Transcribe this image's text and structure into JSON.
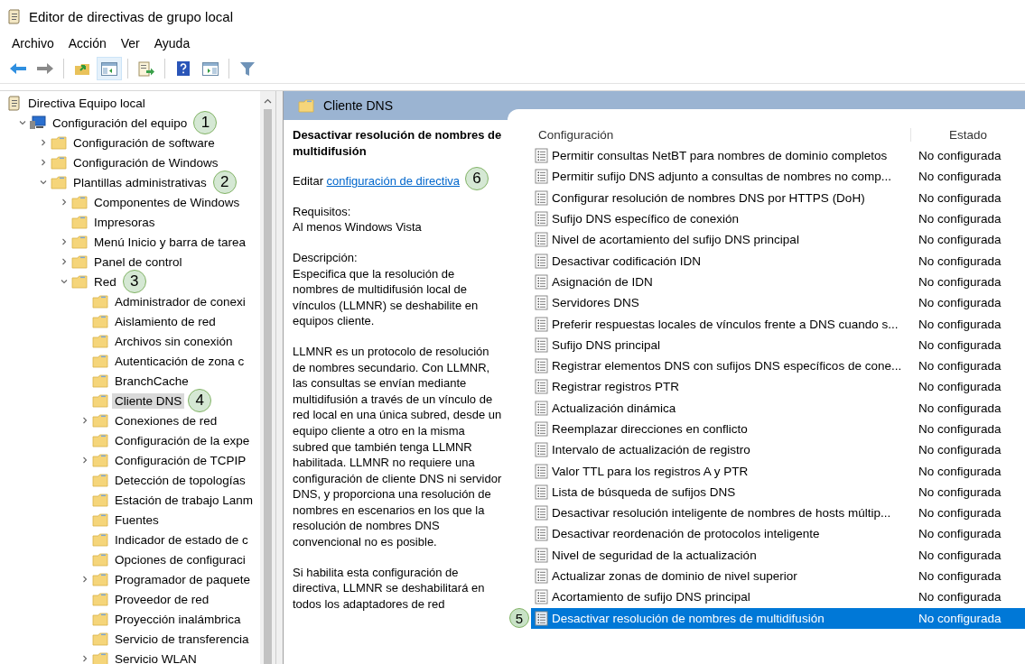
{
  "window": {
    "title": "Editor de directivas de grupo local"
  },
  "menu": [
    {
      "label": "Archivo"
    },
    {
      "label": "Acción"
    },
    {
      "label": "Ver"
    },
    {
      "label": "Ayuda"
    }
  ],
  "toolbar": [
    {
      "kind": "back",
      "pressed": false
    },
    {
      "kind": "forward",
      "pressed": false
    },
    {
      "kind": "separator"
    },
    {
      "kind": "up",
      "pressed": false
    },
    {
      "kind": "tree",
      "pressed": true
    },
    {
      "kind": "separator"
    },
    {
      "kind": "export",
      "pressed": false
    },
    {
      "kind": "separator"
    },
    {
      "kind": "help",
      "pressed": false
    },
    {
      "kind": "pane",
      "pressed": false
    },
    {
      "kind": "separator"
    },
    {
      "kind": "filter",
      "pressed": false
    }
  ],
  "tree": {
    "label": "Directiva Equipo local",
    "selected": false,
    "children": [
      {
        "label": "Configuración del equipo",
        "expanded": true,
        "selected": false,
        "badge": "1",
        "children": [
          {
            "label": "Configuración de software",
            "expanded": false,
            "selected": false
          },
          {
            "label": "Configuración de Windows",
            "expanded": false,
            "selected": false
          },
          {
            "label": "Plantillas administrativas",
            "expanded": true,
            "selected": false,
            "badge": "2",
            "children": [
              {
                "label": "Componentes de Windows",
                "expanded": false,
                "selected": false
              },
              {
                "label": "Impresoras",
                "selected": false
              },
              {
                "label": "Menú Inicio y barra de tarea",
                "expanded": false,
                "selected": false
              },
              {
                "label": "Panel de control",
                "expanded": false,
                "selected": false
              },
              {
                "label": "Red",
                "expanded": true,
                "selected": false,
                "badge": "3",
                "children": [
                  {
                    "label": "Administrador de conexi",
                    "selected": false
                  },
                  {
                    "label": "Aislamiento de red",
                    "selected": false
                  },
                  {
                    "label": "Archivos sin conexión",
                    "selected": false
                  },
                  {
                    "label": "Autenticación de zona c",
                    "selected": false
                  },
                  {
                    "label": "BranchCache",
                    "selected": false
                  },
                  {
                    "label": "Cliente DNS",
                    "selected": true,
                    "badge": "4"
                  },
                  {
                    "label": "Conexiones de red",
                    "expanded": false,
                    "selected": false
                  },
                  {
                    "label": "Configuración de la expe",
                    "selected": false
                  },
                  {
                    "label": "Configuración de TCPIP",
                    "expanded": false,
                    "selected": false
                  },
                  {
                    "label": "Detección de topologías",
                    "selected": false
                  },
                  {
                    "label": "Estación de trabajo Lanm",
                    "selected": false
                  },
                  {
                    "label": "Fuentes",
                    "selected": false
                  },
                  {
                    "label": "Indicador de estado de c",
                    "selected": false
                  },
                  {
                    "label": "Opciones de configuraci",
                    "selected": false
                  },
                  {
                    "label": "Programador de paquete",
                    "expanded": false,
                    "selected": false
                  },
                  {
                    "label": "Proveedor de red",
                    "selected": false
                  },
                  {
                    "label": "Proyección inalámbrica",
                    "selected": false
                  },
                  {
                    "label": "Servicio de transferencia",
                    "selected": false
                  },
                  {
                    "label": "Servicio WLAN",
                    "expanded": false,
                    "selected": false
                  }
                ]
              }
            ]
          }
        ]
      }
    ]
  },
  "content_header": {
    "title": "Cliente DNS"
  },
  "description": {
    "title": "Desactivar resolución de nombres de multidifusión",
    "badge": "6",
    "edit_prefix": "Editar",
    "edit_link": "configuración de directiva",
    "requirements_label": "Requisitos:",
    "requirements": "Al menos Windows Vista",
    "description_label": "Descripción:",
    "paragraphs": [
      "Especifica que la resolución de nombres de multidifusión local de vínculos (LLMNR) se deshabilite en equipos cliente.",
      "LLMNR es un protocolo de resolución de nombres secundario. Con LLMNR, las consultas se envían mediante multidifusión a través de un vínculo de red local en una única subred, desde un equipo cliente a otro en la misma subred que también tenga LLMNR habilitada. LLMNR no requiere una configuración de cliente DNS ni servidor DNS, y proporciona una resolución de nombres en escenarios en los que la resolución de nombres DNS convencional no es posible.",
      "Si habilita esta configuración de directiva, LLMNR se deshabilitará en todos los adaptadores de red"
    ]
  },
  "settings": {
    "columns": [
      "Configuración",
      "Estado"
    ],
    "rows": [
      {
        "name": "Permitir consultas NetBT para nombres de dominio completos",
        "state": "No configurada",
        "selected": false
      },
      {
        "name": "Permitir sufijo DNS adjunto a consultas de nombres no comp...",
        "state": "No configurada",
        "selected": false
      },
      {
        "name": "Configurar resolución de nombres DNS por HTTPS (DoH)",
        "state": "No configurada",
        "selected": false
      },
      {
        "name": "Sufijo DNS específico de conexión",
        "state": "No configurada",
        "selected": false
      },
      {
        "name": "Nivel de acortamiento del sufijo DNS principal",
        "state": "No configurada",
        "selected": false
      },
      {
        "name": "Desactivar codificación IDN",
        "state": "No configurada",
        "selected": false
      },
      {
        "name": "Asignación de IDN",
        "state": "No configurada",
        "selected": false
      },
      {
        "name": "Servidores DNS",
        "state": "No configurada",
        "selected": false
      },
      {
        "name": "Preferir respuestas locales de vínculos frente a DNS cuando s...",
        "state": "No configurada",
        "selected": false
      },
      {
        "name": "Sufijo DNS principal",
        "state": "No configurada",
        "selected": false
      },
      {
        "name": "Registrar elementos DNS con sufijos DNS específicos de cone...",
        "state": "No configurada",
        "selected": false
      },
      {
        "name": "Registrar registros PTR",
        "state": "No configurada",
        "selected": false
      },
      {
        "name": "Actualización dinámica",
        "state": "No configurada",
        "selected": false
      },
      {
        "name": "Reemplazar direcciones en conflicto",
        "state": "No configurada",
        "selected": false
      },
      {
        "name": "Intervalo de actualización de registro",
        "state": "No configurada",
        "selected": false
      },
      {
        "name": "Valor TTL para los registros A y PTR",
        "state": "No configurada",
        "selected": false
      },
      {
        "name": "Lista de búsqueda de sufijos DNS",
        "state": "No configurada",
        "selected": false
      },
      {
        "name": "Desactivar resolución inteligente de nombres de hosts múltip...",
        "state": "No configurada",
        "selected": false
      },
      {
        "name": "Desactivar reordenación de protocolos inteligente",
        "state": "No configurada",
        "selected": false
      },
      {
        "name": "Nivel de seguridad de la actualización",
        "state": "No configurada",
        "selected": false
      },
      {
        "name": "Actualizar zonas de dominio de nivel superior",
        "state": "No configurada",
        "selected": false
      },
      {
        "name": "Acortamiento de sufijo DNS principal",
        "state": "No configurada",
        "selected": false
      },
      {
        "name": "Desactivar resolución de nombres de multidifusión",
        "state": "No configurada",
        "selected": true,
        "badge": "5"
      }
    ]
  }
}
